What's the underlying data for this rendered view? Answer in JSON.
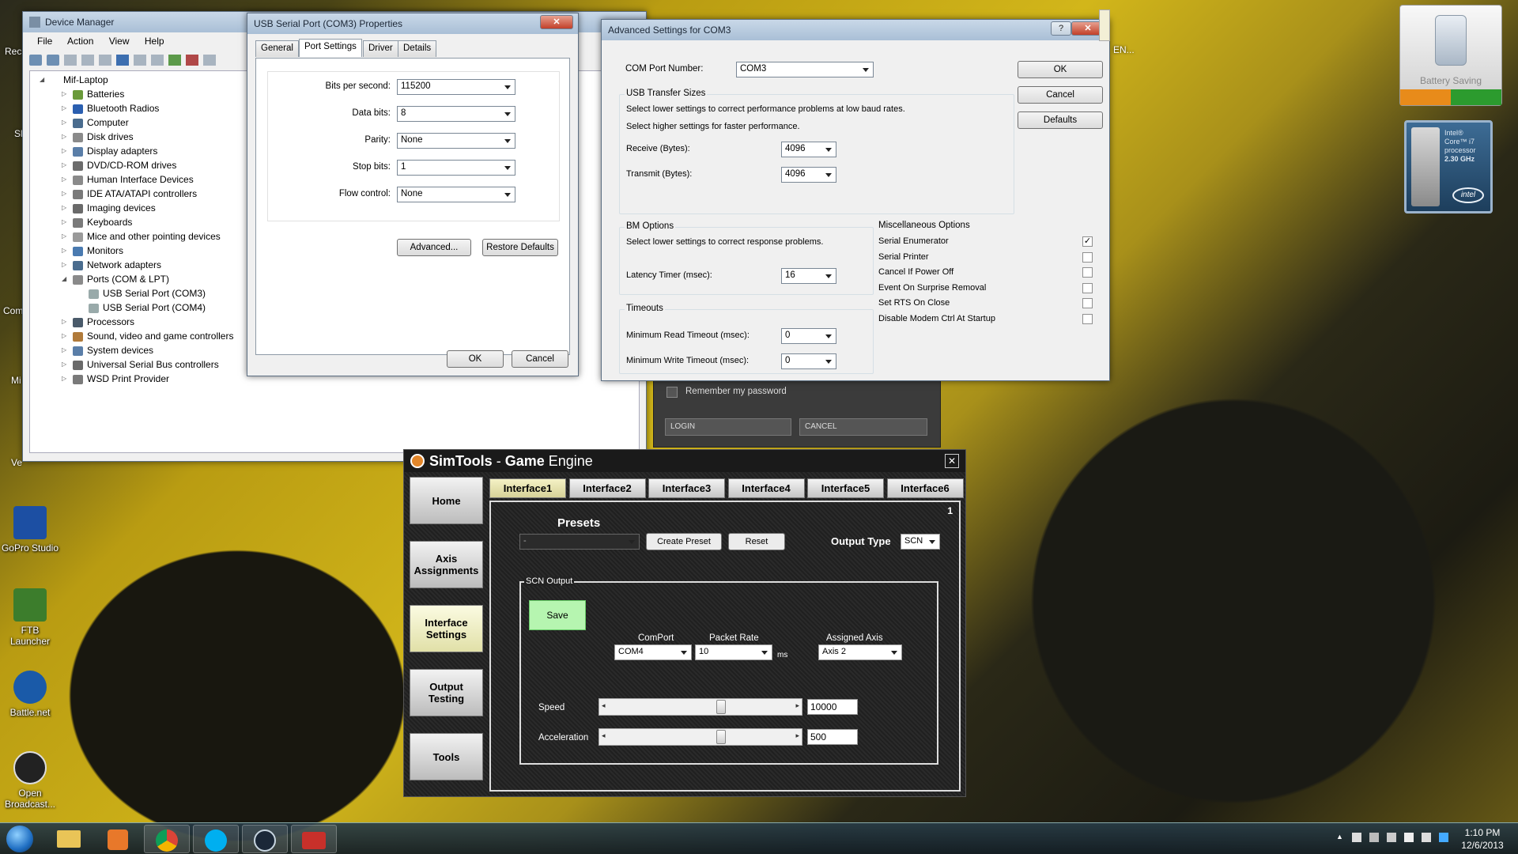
{
  "desktop": {
    "icons": [
      {
        "label": "GoPro Studio",
        "icon": "gopro-icon",
        "color": "#1c4fa3"
      },
      {
        "label": "FTB Launcher",
        "icon": "ftb-icon",
        "color": "#3c7d2c"
      },
      {
        "label": "Battle.net",
        "icon": "battlenet-icon",
        "color": "#1a5aa8"
      },
      {
        "label": "Open Broadcast...",
        "icon": "obs-icon",
        "color": "#222222"
      }
    ],
    "partial_labels": [
      "Rec",
      "Sl",
      "Com",
      "Mi",
      "Ve"
    ]
  },
  "device_manager": {
    "title": "Device Manager",
    "menu": [
      "File",
      "Action",
      "View",
      "Help"
    ],
    "root": "Mif-Laptop",
    "items": [
      "Batteries",
      "Bluetooth Radios",
      "Computer",
      "Disk drives",
      "Display adapters",
      "DVD/CD-ROM drives",
      "Human Interface Devices",
      "IDE ATA/ATAPI controllers",
      "Imaging devices",
      "Keyboards",
      "Mice and other pointing devices",
      "Monitors",
      "Network adapters",
      "Ports (COM & LPT)",
      "USB Serial Port (COM3)",
      "USB Serial Port (COM4)",
      "Processors",
      "Sound, video and game controllers",
      "System devices",
      "Universal Serial Bus controllers",
      "WSD Print Provider"
    ]
  },
  "props": {
    "title": "USB Serial Port (COM3) Properties",
    "tabs": [
      "General",
      "Port Settings",
      "Driver",
      "Details"
    ],
    "fields": [
      {
        "label": "Bits per second:",
        "value": "115200"
      },
      {
        "label": "Data bits:",
        "value": "8"
      },
      {
        "label": "Parity:",
        "value": "None"
      },
      {
        "label": "Stop bits:",
        "value": "1"
      },
      {
        "label": "Flow control:",
        "value": "None"
      }
    ],
    "advanced": "Advanced...",
    "restore": "Restore Defaults",
    "ok": "OK",
    "cancel": "Cancel"
  },
  "adv": {
    "title": "Advanced Settings for COM3",
    "help": "?",
    "com_label": "COM Port Number:",
    "com_value": "COM3",
    "usb_group": "USB Transfer Sizes",
    "usb_line1": "Select lower settings to correct performance problems at low baud rates.",
    "usb_line2": "Select higher settings for faster performance.",
    "receive_label": "Receive (Bytes):",
    "receive_value": "4096",
    "transmit_label": "Transmit (Bytes):",
    "transmit_value": "4096",
    "bm_group": "BM Options",
    "bm_line": "Select lower settings to correct response problems.",
    "latency_label": "Latency Timer (msec):",
    "latency_value": "16",
    "timeouts_group": "Timeouts",
    "read_label": "Minimum Read Timeout (msec):",
    "read_value": "0",
    "write_label": "Minimum Write Timeout (msec):",
    "write_value": "0",
    "misc_group": "Miscellaneous Options",
    "misc": [
      {
        "label": "Serial Enumerator",
        "checked": "✓"
      },
      {
        "label": "Serial Printer",
        "checked": ""
      },
      {
        "label": "Cancel If Power Off",
        "checked": ""
      },
      {
        "label": "Event On Surprise Removal",
        "checked": ""
      },
      {
        "label": "Set RTS On Close",
        "checked": ""
      },
      {
        "label": "Disable Modem Ctrl At Startup",
        "checked": ""
      }
    ],
    "ok": "OK",
    "cancel": "Cancel",
    "defaults": "Defaults"
  },
  "login": {
    "remember": "Remember my password",
    "login": "LOGIN",
    "cancel": "CANCEL"
  },
  "simtools": {
    "title_a": "SimTools",
    "title_b": " - ",
    "title_c": "Game",
    "title_d": " Engine",
    "nav": [
      "Home",
      "Axis Assignments",
      "Interface Settings",
      "Output Testing",
      "Tools"
    ],
    "tabs": [
      "Interface1",
      "Interface2",
      "Interface3",
      "Interface4",
      "Interface5",
      "Interface6"
    ],
    "page_number": "1",
    "presets_label": "Presets",
    "preset_value": "-",
    "create_preset": "Create Preset",
    "reset": "Reset",
    "output_type_label": "Output Type",
    "output_type_value": "SCN",
    "scn_group": "SCN Output",
    "save": "Save",
    "comport_label": "ComPort",
    "comport_value": "COM4",
    "packet_label": "Packet Rate",
    "packet_value": "10",
    "packet_unit": "ms",
    "axis_label": "Assigned Axis",
    "axis_value": "Axis 2",
    "speed_label": "Speed",
    "speed_value": "10000",
    "accel_label": "Acceleration",
    "accel_value": "500"
  },
  "gadgets": {
    "battery_label": "Battery Saving",
    "cpu_line1": "Intel®",
    "cpu_line2": "Core™ i7",
    "cpu_line3": "processor",
    "cpu_line4": "2.30 GHz",
    "cpu_logo": "intel"
  },
  "taskbar": {
    "time": "1:10 PM",
    "date": "12/6/2013",
    "apps": [
      "start-orb-icon",
      "explorer-icon",
      "media-player-icon",
      "chrome-icon",
      "skype-icon",
      "steam-icon",
      "toolbox-icon"
    ]
  },
  "colors": {
    "accent_green": "#b6f5b0",
    "sim_bg": "#1d1d1d",
    "titlebar": "#b7cbe0"
  }
}
